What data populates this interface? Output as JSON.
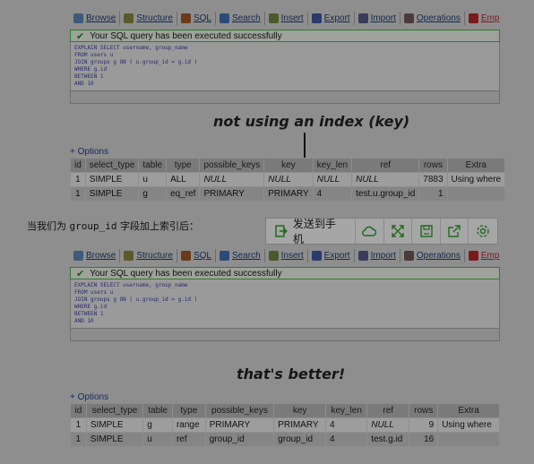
{
  "tabs": [
    "Browse",
    "Structure",
    "SQL",
    "Search",
    "Insert",
    "Export",
    "Import",
    "Operations",
    "Emp"
  ],
  "success_message": "Your SQL query has been executed successfully",
  "sql_lines": [
    "EXPLAIN SELECT username, group_name",
    "FROM users u",
    "JOIN groups g ON ( u.group_id = g.id )",
    "WHERE g.id",
    "BETWEEN 1",
    "AND 10"
  ],
  "caption_top": "not using an index (key)",
  "caption_bottom": "that's better!",
  "options_label": "+ Options",
  "columns": [
    "id",
    "select_type",
    "table",
    "type",
    "possible_keys",
    "key",
    "key_len",
    "ref",
    "rows",
    "Extra"
  ],
  "table1": [
    [
      "1",
      "SIMPLE",
      "u",
      "ALL",
      "NULL",
      "NULL",
      "NULL",
      "NULL",
      "7883",
      "Using where"
    ],
    [
      "1",
      "SIMPLE",
      "g",
      "eq_ref",
      "PRIMARY",
      "PRIMARY",
      "4",
      "test.u.group_id",
      "1",
      ""
    ]
  ],
  "table2": [
    [
      "1",
      "SIMPLE",
      "g",
      "range",
      "PRIMARY",
      "PRIMARY",
      "4",
      "NULL",
      "9",
      "Using where"
    ],
    [
      "1",
      "SIMPLE",
      "u",
      "ref",
      "group_id",
      "group_id",
      "4",
      "test.g.id",
      "16",
      ""
    ]
  ],
  "cn_prefix": "当我们为 ",
  "cn_code": "group_id",
  "cn_suffix": " 字段加上索引后：",
  "phone_bar": {
    "send_label": "发送到手机",
    "icons": [
      "cloud-icon",
      "expand-icon",
      "save-icon",
      "share-icon",
      "settings-icon"
    ]
  }
}
